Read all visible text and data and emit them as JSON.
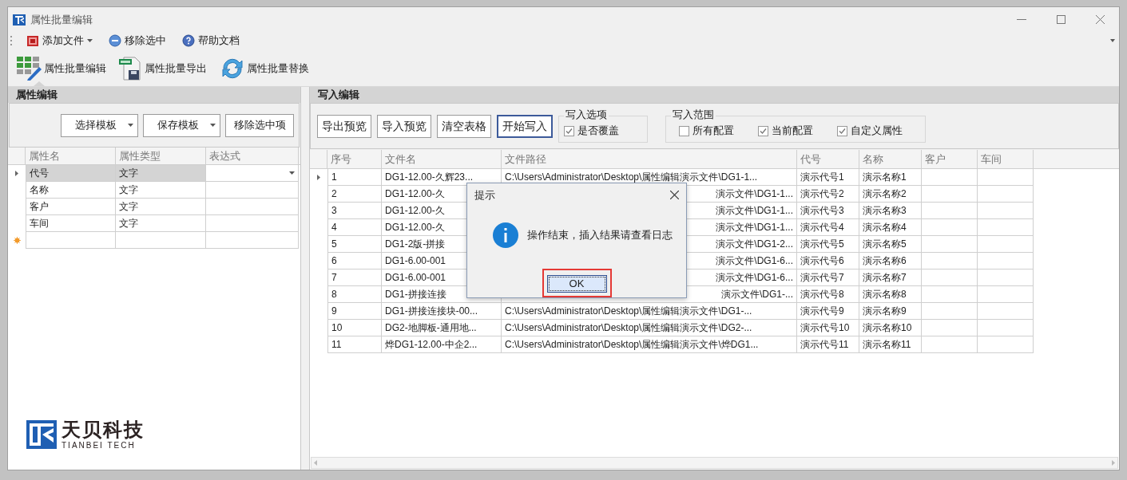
{
  "window": {
    "title": "属性批量编辑"
  },
  "menu": [
    {
      "label": "添加文件",
      "dropdown": true,
      "kind": "cube"
    },
    {
      "label": "移除选中",
      "dropdown": false,
      "kind": "remove"
    },
    {
      "label": "帮助文档",
      "dropdown": false,
      "kind": "help"
    }
  ],
  "toolbar": [
    {
      "label": "属性批量编辑",
      "kind": "grid",
      "selected": true
    },
    {
      "label": "属性批量导出",
      "kind": "sheet",
      "selected": false
    },
    {
      "label": "属性批量替换",
      "kind": "refresh",
      "selected": false
    }
  ],
  "left_panel": {
    "title": "属性编辑",
    "buttons": [
      {
        "label": "选择模板",
        "dropdown": true
      },
      {
        "label": "保存模板",
        "dropdown": true
      },
      {
        "label": "移除选中项",
        "dropdown": false
      }
    ],
    "columns": [
      "属性名",
      "属性类型",
      "表达式"
    ],
    "rows": [
      {
        "cells": [
          "代号",
          "文字"
        ],
        "selected": true
      },
      {
        "cells": [
          "名称",
          "文字"
        ],
        "selected": false
      },
      {
        "cells": [
          "客户",
          "文字"
        ],
        "selected": false
      },
      {
        "cells": [
          "车间",
          "文字"
        ],
        "selected": false
      }
    ],
    "logo": {
      "name": "天贝科技",
      "tagline": "TIANBEI TECH"
    }
  },
  "right_panel": {
    "title": "写入编辑",
    "buttons": [
      {
        "label": "导出预览",
        "focused": false
      },
      {
        "label": "导入预览",
        "focused": false
      },
      {
        "label": "清空表格",
        "focused": false
      },
      {
        "label": "开始写入",
        "focused": true
      }
    ],
    "write_options": {
      "title": "写入选项",
      "checkboxes": [
        {
          "label": "是否覆盖",
          "checked": true
        }
      ]
    },
    "write_range": {
      "title": "写入范围",
      "checkboxes": [
        {
          "label": "所有配置",
          "checked": false
        },
        {
          "label": "当前配置",
          "checked": true
        },
        {
          "label": "自定义属性",
          "checked": true
        }
      ]
    },
    "columns": [
      "序号",
      "文件名",
      "文件路径",
      "代号",
      "名称",
      "客户",
      "车间"
    ],
    "rows": [
      {
        "cells": [
          "1",
          "DG1-12.00-久辉23...",
          "C:\\Users\\Administrator\\Desktop\\属性编辑演示文件\\DG1-1...",
          "演示代号1",
          "演示名称1"
        ],
        "selected": true,
        "under_dialog": false
      },
      {
        "cells": [
          "2",
          "DG1-12.00-久",
          "演示文件\\DG1-1...",
          "演示代号2",
          "演示名称2"
        ],
        "selected": false,
        "under_dialog": true
      },
      {
        "cells": [
          "3",
          "DG1-12.00-久",
          "演示文件\\DG1-1...",
          "演示代号3",
          "演示名称3"
        ],
        "selected": false,
        "under_dialog": true
      },
      {
        "cells": [
          "4",
          "DG1-12.00-久",
          "演示文件\\DG1-1...",
          "演示代号4",
          "演示名称4"
        ],
        "selected": false,
        "under_dialog": true
      },
      {
        "cells": [
          "5",
          "DG1-2版-拼接",
          "演示文件\\DG1-2...",
          "演示代号5",
          "演示名称5"
        ],
        "selected": false,
        "under_dialog": true
      },
      {
        "cells": [
          "6",
          "DG1-6.00-001",
          "演示文件\\DG1-6...",
          "演示代号6",
          "演示名称6"
        ],
        "selected": false,
        "under_dialog": true
      },
      {
        "cells": [
          "7",
          "DG1-6.00-001",
          "演示文件\\DG1-6...",
          "演示代号7",
          "演示名称7"
        ],
        "selected": false,
        "under_dialog": true
      },
      {
        "cells": [
          "8",
          "DG1-拼接连接",
          "演示文件\\DG1-...",
          "演示代号8",
          "演示名称8"
        ],
        "selected": false,
        "under_dialog": true
      },
      {
        "cells": [
          "9",
          "DG1-拼接连接块-00...",
          "C:\\Users\\Administrator\\Desktop\\属性编辑演示文件\\DG1-...",
          "演示代号9",
          "演示名称9"
        ],
        "selected": false,
        "under_dialog": false
      },
      {
        "cells": [
          "10",
          "DG2-地脚板-通用地...",
          "C:\\Users\\Administrator\\Desktop\\属性编辑演示文件\\DG2-...",
          "演示代号10",
          "演示名称10"
        ],
        "selected": false,
        "under_dialog": false
      },
      {
        "cells": [
          "11",
          "烨DG1-12.00-中企2...",
          "C:\\Users\\Administrator\\Desktop\\属性编辑演示文件\\烨DG1...",
          "演示代号11",
          "演示名称11"
        ],
        "selected": false,
        "under_dialog": false
      }
    ]
  },
  "dialog": {
    "title": "提示",
    "message": "操作结束，插入结果请查看日志",
    "ok": "OK",
    "highlighted": true
  }
}
